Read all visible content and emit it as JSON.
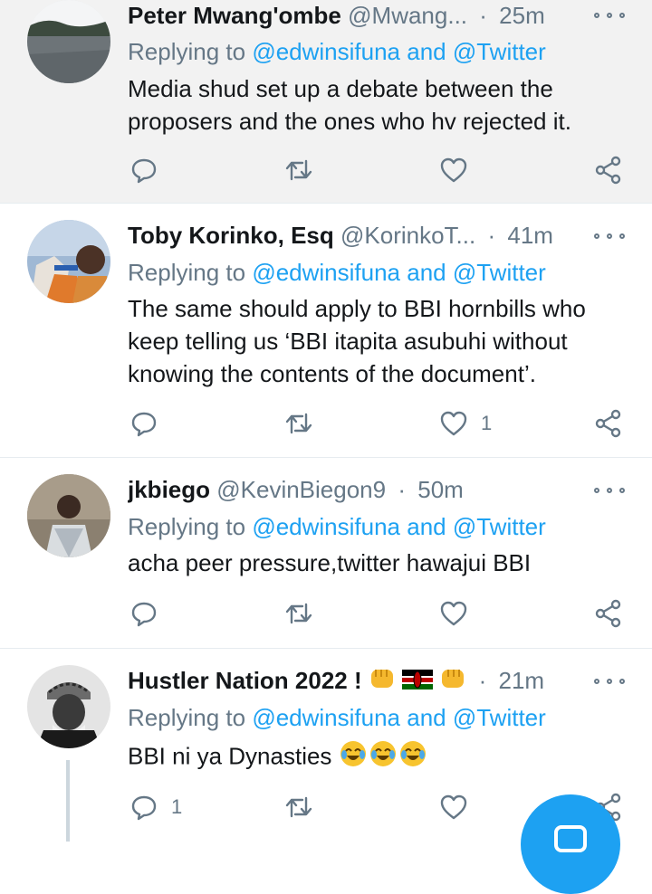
{
  "colors": {
    "accent": "#1da1f2",
    "muted": "#657786",
    "text": "#14171a",
    "divider": "#e6ecf0",
    "highlight_bg": "#f2f2f2"
  },
  "tweets": [
    {
      "name": "Peter Mwang'ombe",
      "handle": "@Mwang...",
      "time": "25m",
      "replying_prefix": "Replying to",
      "replying_mentions": "@edwinsifuna and @Twitter",
      "text_lines": [
        "Media shud set up a debate between the",
        "proposers and the ones who hv rejected it."
      ],
      "reply_count": "",
      "like_count": ""
    },
    {
      "name": "Toby Korinko, Esq",
      "handle": "@KorinkoT...",
      "time": "41m",
      "replying_prefix": "Replying to",
      "replying_mentions": "@edwinsifuna and @Twitter",
      "text_lines": [
        "The same should apply to BBI hornbills who",
        "keep telling us ‘BBI itapita asubuhi without",
        "knowing the contents of the document’."
      ],
      "reply_count": "",
      "like_count": "1"
    },
    {
      "name": "jkbiego",
      "handle": "@KevinBiegon9",
      "time": "50m",
      "replying_prefix": "Replying to",
      "replying_mentions": "@edwinsifuna and @Twitter",
      "text_lines": [
        "acha peer pressure,twitter hawajui BBI"
      ],
      "reply_count": "",
      "like_count": ""
    },
    {
      "name": "Hustler Nation 2022 !",
      "handle": "",
      "time": "21m",
      "replying_prefix": "Replying to",
      "replying_mentions": "@edwinsifuna and @Twitter",
      "text_lines": [
        "BBI ni ya Dynasties"
      ],
      "reply_count": "1",
      "like_count": ""
    }
  ],
  "icons": {
    "reply": "reply-icon",
    "retweet": "retweet-icon",
    "like": "heart-icon",
    "share": "share-icon",
    "more": "more-icon",
    "compose": "compose-icon"
  }
}
